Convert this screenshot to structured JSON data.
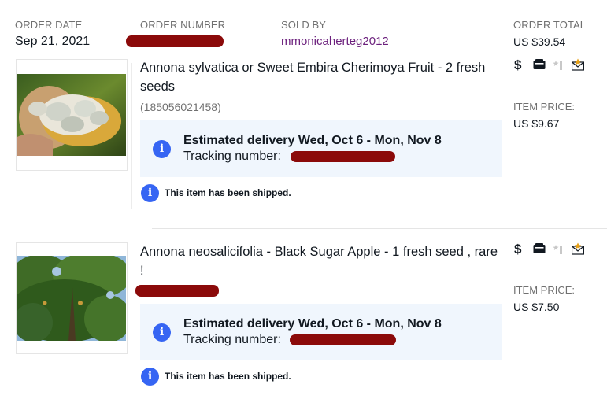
{
  "order": {
    "date_label": "ORDER DATE",
    "date_value": "Sep 21, 2021",
    "number_label": "ORDER NUMBER",
    "sold_by_label": "SOLD BY",
    "seller": "mmonicaherteg2012",
    "total_label": "ORDER TOTAL",
    "total_value": "US $39.54"
  },
  "status_icons": [
    {
      "name": "dollar-icon",
      "glyph": "$"
    },
    {
      "name": "shipping-box-icon",
      "glyph": ""
    },
    {
      "name": "star-rating-icon",
      "glyph": ""
    },
    {
      "name": "envelope-message-icon",
      "glyph": ""
    }
  ],
  "items": [
    {
      "title": "Annona sylvatica or Sweet Embira Cherimoya Fruit - 2 fresh seeds",
      "item_number": "(185056021458)",
      "delivery": "Estimated delivery Wed, Oct 6 - Mon, Nov 8",
      "tracking_label": "Tracking number:",
      "shipped_note": "This item has been shipped.",
      "price_label": "ITEM PRICE:",
      "price_value": "US $9.67",
      "info_glyph": "i"
    },
    {
      "title": "Annona neosalicifolia - Black Sugar Apple - 1 fresh seed , rare !",
      "delivery": "Estimated delivery Wed, Oct 6 - Mon, Nov 8",
      "tracking_label": "Tracking number:",
      "shipped_note": "This item has been shipped.",
      "price_label": "ITEM PRICE:",
      "price_value": "US $7.50",
      "info_glyph": "i"
    }
  ],
  "colors": {
    "seller_link": "#6b1f7c",
    "info_blue": "#3665f3",
    "delivery_bg": "#f0f6fd",
    "redaction": "#8b0a0a"
  }
}
